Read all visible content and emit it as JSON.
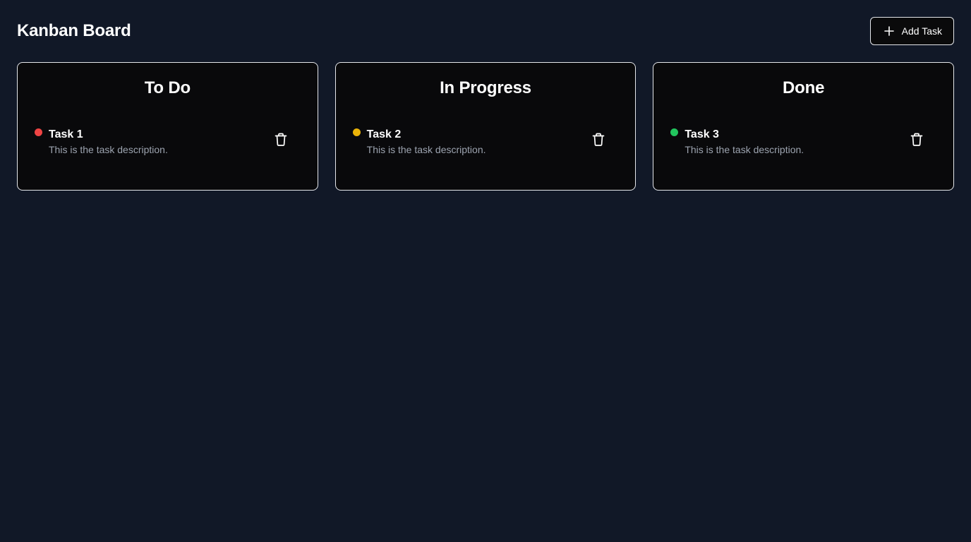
{
  "header": {
    "title": "Kanban Board",
    "add_task_label": "Add Task",
    "add_task_icon": "plus-icon"
  },
  "colors": {
    "background": "#111827",
    "column_background": "#09090b",
    "border": "#e5e7eb",
    "todo_dot": "#ef4444",
    "in_progress_dot": "#eab308",
    "done_dot": "#22c55e"
  },
  "columns": [
    {
      "title": "To Do",
      "tasks": [
        {
          "title": "Task 1",
          "description": "This is the task description.",
          "status_color": "#ef4444",
          "delete_icon": "trash-icon"
        }
      ]
    },
    {
      "title": "In Progress",
      "tasks": [
        {
          "title": "Task 2",
          "description": "This is the task description.",
          "status_color": "#eab308",
          "delete_icon": "trash-icon"
        }
      ]
    },
    {
      "title": "Done",
      "tasks": [
        {
          "title": "Task 3",
          "description": "This is the task description.",
          "status_color": "#22c55e",
          "delete_icon": "trash-icon"
        }
      ]
    }
  ]
}
